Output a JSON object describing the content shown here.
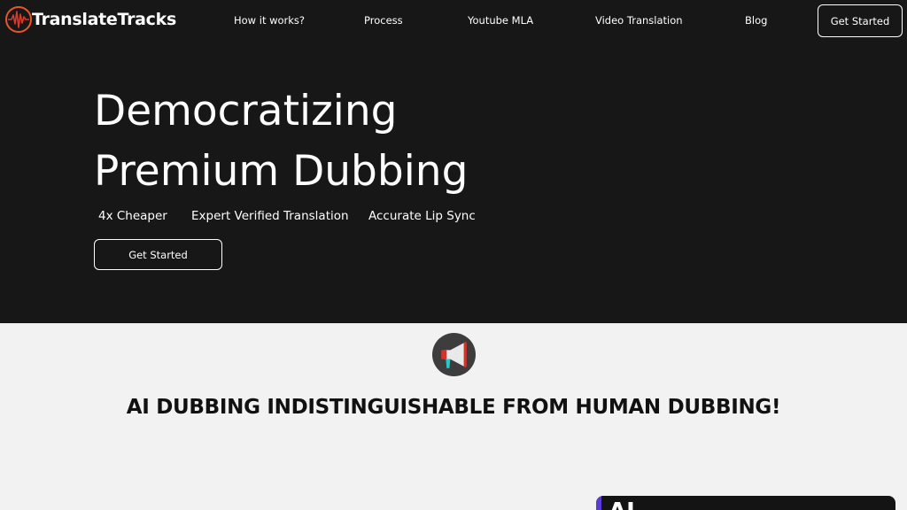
{
  "header": {
    "logo_text": "TranslateTracks",
    "nav": [
      "How it works?",
      "Process",
      "Youtube MLA",
      "Video Translation",
      "Blog"
    ],
    "cta_label": "Get Started"
  },
  "hero": {
    "title_line1": "Democratizing",
    "title_line2": "Premium Dubbing",
    "features": [
      "4x Cheaper",
      "Expert Verified Translation",
      "Accurate Lip Sync"
    ],
    "cta_label": "Get Started"
  },
  "section": {
    "icon": "megaphone-icon",
    "tagline": "AI DUBBING INDISTINGUISHABLE FROM HUMAN DUBBING!",
    "card_text": "AI"
  },
  "colors": {
    "hero_bg": "#171717",
    "page_bg": "#f2f2f2",
    "logo_accent": "#e8562a",
    "card_accent": "#5b3bd6"
  }
}
